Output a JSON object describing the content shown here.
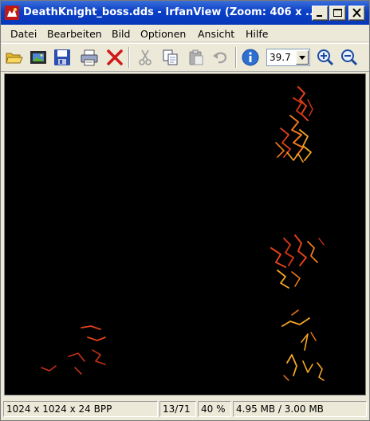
{
  "window": {
    "title": "DeathKnight_boss.dds - IrfanView (Zoom: 406 x ...",
    "icon": "irfanview-app-icon",
    "controls": [
      "minimize-icon",
      "maximize-icon",
      "close-icon"
    ]
  },
  "menu": {
    "items": [
      {
        "label": "Datei"
      },
      {
        "label": "Bearbeiten"
      },
      {
        "label": "Bild"
      },
      {
        "label": "Optionen"
      },
      {
        "label": "Ansicht"
      },
      {
        "label": "Hilfe"
      }
    ]
  },
  "toolbar": {
    "icons": [
      "open-folder-icon",
      "slideshow-icon",
      "save-icon",
      "print-icon",
      "delete-icon",
      "cut-icon",
      "copy-icon",
      "paste-icon",
      "undo-icon",
      "info-icon",
      "zoom-in-icon",
      "zoom-out-icon"
    ],
    "zoom_value": "39.7"
  },
  "viewer": {
    "background": "#000000",
    "texture_colors": [
      "#e0401a",
      "#f07a1c",
      "#f5a623",
      "#c83214"
    ]
  },
  "status": {
    "dimensions": "1024 x 1024 x 24 BPP",
    "index": "13/71",
    "zoom": "40 %",
    "memory": "4.95 MB / 3.00 MB"
  }
}
